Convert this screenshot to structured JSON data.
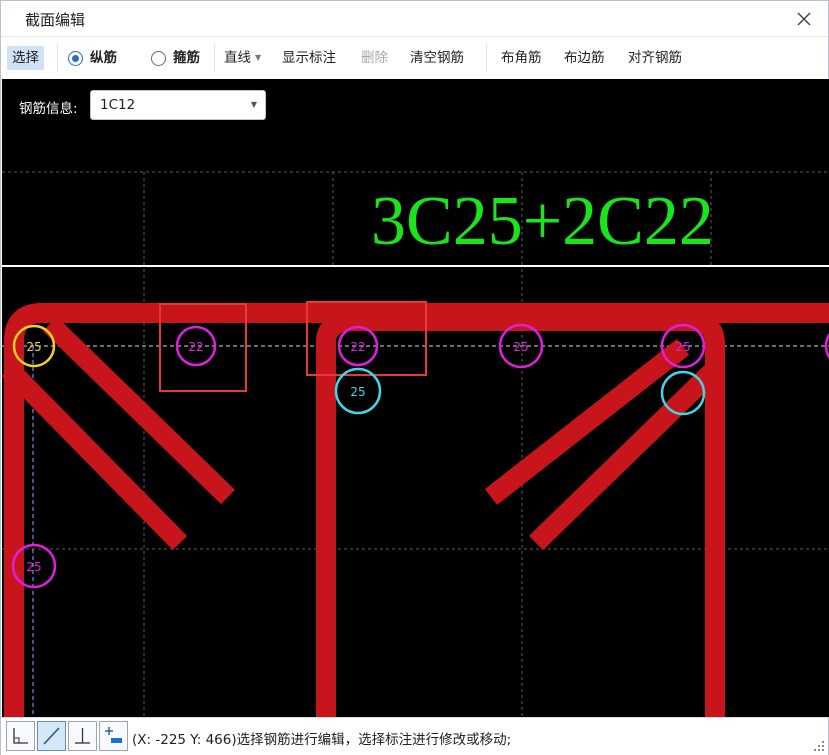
{
  "window": {
    "title": "截面编辑"
  },
  "toolbar": {
    "select": "选择",
    "longitudinal": "纵筋",
    "stirrup": "箍筋",
    "line_mode": "直线",
    "show_label": "显示标注",
    "delete": "删除",
    "clear_rebar": "清空钢筋",
    "corner_rebar": "布角筋",
    "edge_rebar": "布边筋",
    "align_rebar": "对齐钢筋"
  },
  "rebar_info": {
    "label": "钢筋信息:",
    "value": "1C12"
  },
  "canvas": {
    "annotation": "3C25+2C22",
    "colors": {
      "stirrup": "#c8151c",
      "magenta": "#e01ee0",
      "cyan": "#3fd6e6",
      "yellow": "#f3d21d",
      "text_green": "#18e61a",
      "selection": "#e53a3a"
    },
    "bars": [
      {
        "label": "25",
        "color": "yellow"
      },
      {
        "label": "22",
        "color": "magenta"
      },
      {
        "label": "22",
        "color": "magenta"
      },
      {
        "label": "25",
        "color": "magenta"
      },
      {
        "label": "25",
        "color": "magenta"
      },
      {
        "label": "25",
        "color": "cyan"
      },
      {
        "label": "25",
        "color": "magenta"
      }
    ]
  },
  "status": {
    "text": "(X: -225 Y: 466)选择钢筋进行编辑，选择标注进行修改或移动;",
    "tools": [
      "orthogonal-corner-icon",
      "diagonal-line-icon",
      "perpendicular-icon",
      "add-point-icon"
    ]
  }
}
